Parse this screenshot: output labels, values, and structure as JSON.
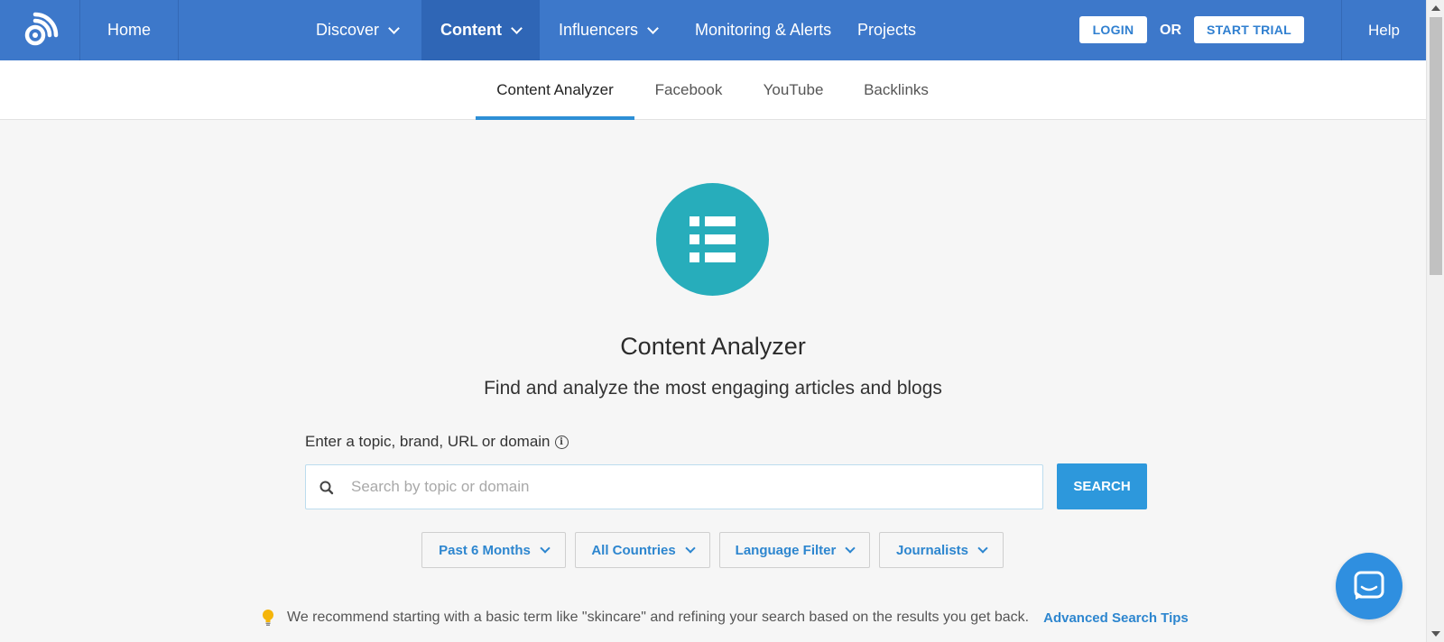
{
  "nav": {
    "home": "Home",
    "discover": "Discover",
    "content": "Content",
    "influencers": "Influencers",
    "monitoring": "Monitoring & Alerts",
    "projects": "Projects",
    "login": "LOGIN",
    "or": "OR",
    "start_trial": "START TRIAL",
    "help": "Help"
  },
  "subtabs": [
    "Content Analyzer",
    "Facebook",
    "YouTube",
    "Backlinks"
  ],
  "main": {
    "title": "Content Analyzer",
    "subtitle": "Find and analyze the most engaging articles and blogs",
    "search_label": "Enter a topic, brand, URL or domain",
    "search_placeholder": "Search by topic or domain",
    "search_button": "SEARCH",
    "filters": [
      "Past 6 Months",
      "All Countries",
      "Language Filter",
      "Journalists"
    ],
    "tip": "We recommend starting with a basic term like \"skincare\" and refining your search based on the results you get back.",
    "tip_link": "Advanced Search Tips"
  },
  "colors": {
    "nav_bg": "#3d78ca",
    "accent": "#2d98dc",
    "hero_icon_bg": "#27adbb"
  }
}
